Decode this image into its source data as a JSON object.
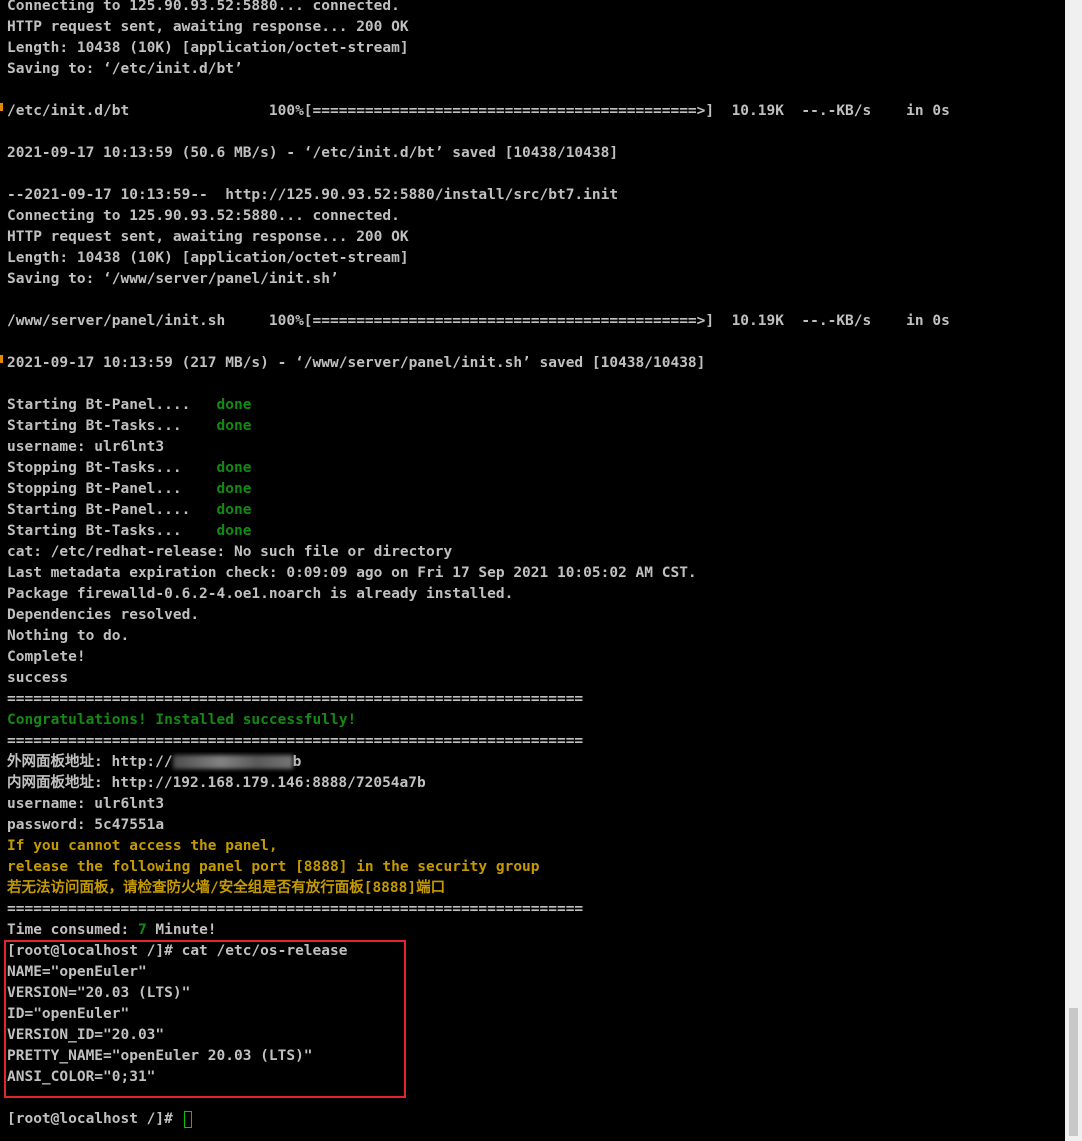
{
  "terminal": {
    "colors": {
      "background": "#000000",
      "text": "#c0c0c0",
      "done": "#138a13",
      "warning": "#c49a00",
      "highlight_border": "#e0252b",
      "cursor": "#00c800"
    },
    "lines": [
      "Connecting to 125.90.93.52:5880... connected.",
      "HTTP request sent, awaiting response... 200 OK",
      "Length: 10438 (10K) [application/octet-stream]",
      "Saving to: ‘/etc/init.d/bt’",
      "",
      "/etc/init.d/bt                100%[============================================>]  10.19K  --.-KB/s    in 0s",
      "",
      "2021-09-17 10:13:59 (50.6 MB/s) - ‘/etc/init.d/bt’ saved [10438/10438]",
      "",
      "--2021-09-17 10:13:59--  http://125.90.93.52:5880/install/src/bt7.init",
      "Connecting to 125.90.93.52:5880... connected.",
      "HTTP request sent, awaiting response... 200 OK",
      "Length: 10438 (10K) [application/octet-stream]",
      "Saving to: ‘/www/server/panel/init.sh’",
      "",
      "/www/server/panel/init.sh     100%[============================================>]  10.19K  --.-KB/s    in 0s",
      "",
      "2021-09-17 10:13:59 (217 MB/s) - ‘/www/server/panel/init.sh’ saved [10438/10438]",
      ""
    ],
    "status_lines": [
      {
        "label": "Starting Bt-Panel....   ",
        "status": "done"
      },
      {
        "label": "Starting Bt-Tasks...    ",
        "status": "done"
      },
      {
        "label": "username: ulr6lnt3",
        "status": ""
      },
      {
        "label": "Stopping Bt-Tasks...    ",
        "status": "done"
      },
      {
        "label": "Stopping Bt-Panel...    ",
        "status": "done"
      },
      {
        "label": "Starting Bt-Panel....   ",
        "status": "done"
      },
      {
        "label": "Starting Bt-Tasks...    ",
        "status": "done"
      }
    ],
    "lines2": [
      "cat: /etc/redhat-release: No such file or directory",
      "Last metadata expiration check: 0:09:09 ago on Fri 17 Sep 2021 10:05:02 AM CST.",
      "Package firewalld-0.6.2-4.oe1.noarch is already installed.",
      "Dependencies resolved.",
      "Nothing to do.",
      "Complete!",
      "success",
      "=================================================================="
    ],
    "congrats": "Congratulations! Installed successfully!",
    "separator": "==================================================================",
    "panel_external_prefix": "外网面板地址: http://",
    "panel_external_suffix": "b",
    "panel_internal": "内网面板地址: http://192.168.179.146:8888/72054a7b",
    "username": "username: ulr6lnt3",
    "password": "password: 5c47551a",
    "warnings": [
      "If you cannot access the panel,",
      "release the following panel port [8888] in the security group",
      "若无法访问面板，请检查防火墙/安全组是否有放行面板[8888]端口"
    ],
    "time_prefix": "Time consumed: ",
    "time_value": "7",
    "time_suffix": " Minute!",
    "os_release": [
      "[root@localhost /]# cat /etc/os-release",
      "NAME=\"openEuler\"",
      "VERSION=\"20.03 (LTS)\"",
      "ID=\"openEuler\"",
      "VERSION_ID=\"20.03\"",
      "PRETTY_NAME=\"openEuler 20.03 (LTS)\"",
      "ANSI_COLOR=\"0;31\""
    ],
    "prompt": "[root@localhost /]# "
  }
}
